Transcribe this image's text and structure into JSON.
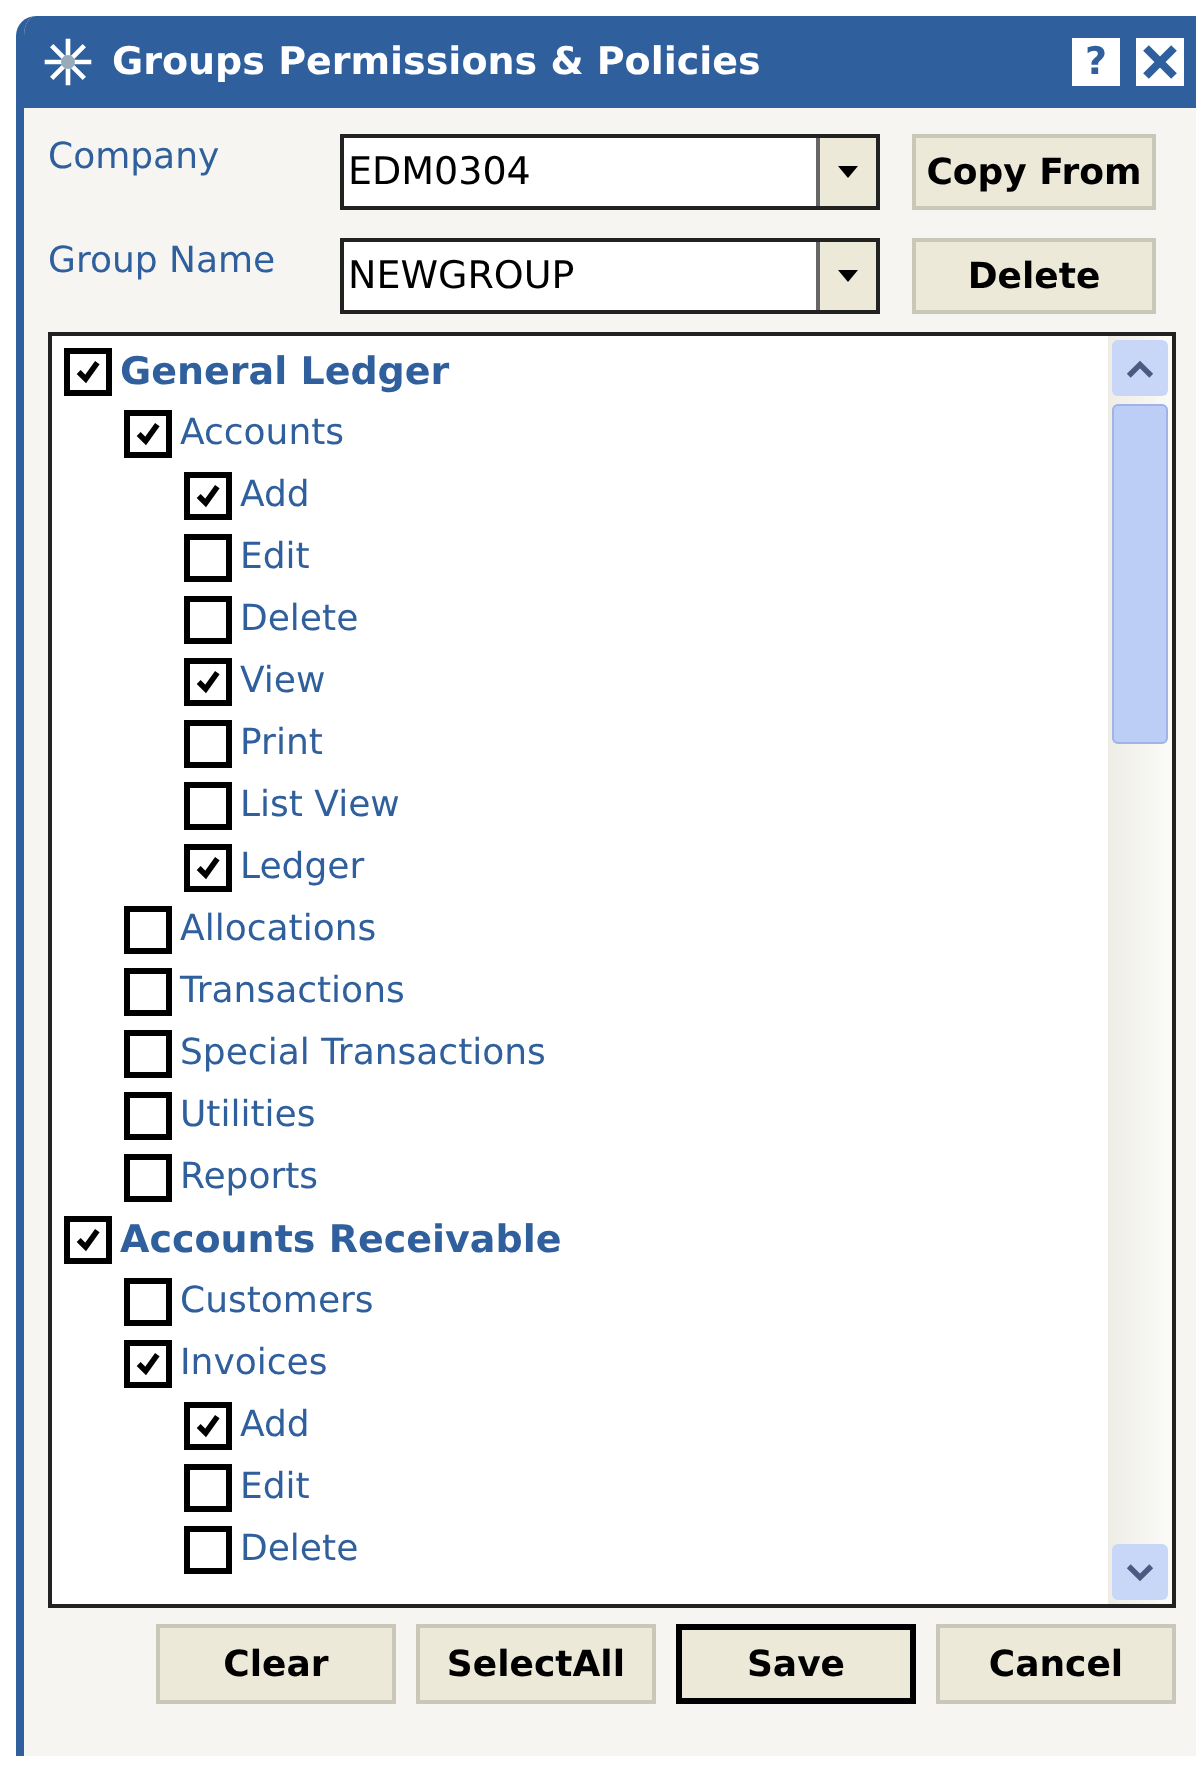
{
  "window": {
    "title": "Groups Permissions & Policies",
    "help": "?"
  },
  "fields": [
    {
      "label": "Company",
      "value": "EDM0304",
      "button": "Copy From"
    },
    {
      "label": "Group Name",
      "value": "NEWGROUP",
      "button": "Delete"
    }
  ],
  "tree": [
    {
      "label": "General Ledger",
      "checked": true,
      "children": [
        {
          "label": "Accounts",
          "checked": true,
          "children": [
            {
              "label": "Add",
              "checked": true
            },
            {
              "label": "Edit",
              "checked": false
            },
            {
              "label": "Delete",
              "checked": false
            },
            {
              "label": "View",
              "checked": true
            },
            {
              "label": "Print",
              "checked": false
            },
            {
              "label": "List View",
              "checked": false
            },
            {
              "label": "Ledger",
              "checked": true
            }
          ]
        },
        {
          "label": "Allocations",
          "checked": false
        },
        {
          "label": "Transactions",
          "checked": false
        },
        {
          "label": "Special Transactions",
          "checked": false
        },
        {
          "label": "Utilities",
          "checked": false
        },
        {
          "label": "Reports",
          "checked": false
        }
      ]
    },
    {
      "label": "Accounts Receivable",
      "checked": true,
      "children": [
        {
          "label": "Customers",
          "checked": false
        },
        {
          "label": "Invoices",
          "checked": true,
          "children": [
            {
              "label": "Add",
              "checked": true
            },
            {
              "label": "Edit",
              "checked": false
            },
            {
              "label": "Delete",
              "checked": false
            }
          ]
        }
      ]
    }
  ],
  "buttons": [
    {
      "label": "Clear",
      "default": false
    },
    {
      "label": "SelectAll",
      "default": false
    },
    {
      "label": "Save",
      "default": true
    },
    {
      "label": "Cancel",
      "default": false
    }
  ]
}
